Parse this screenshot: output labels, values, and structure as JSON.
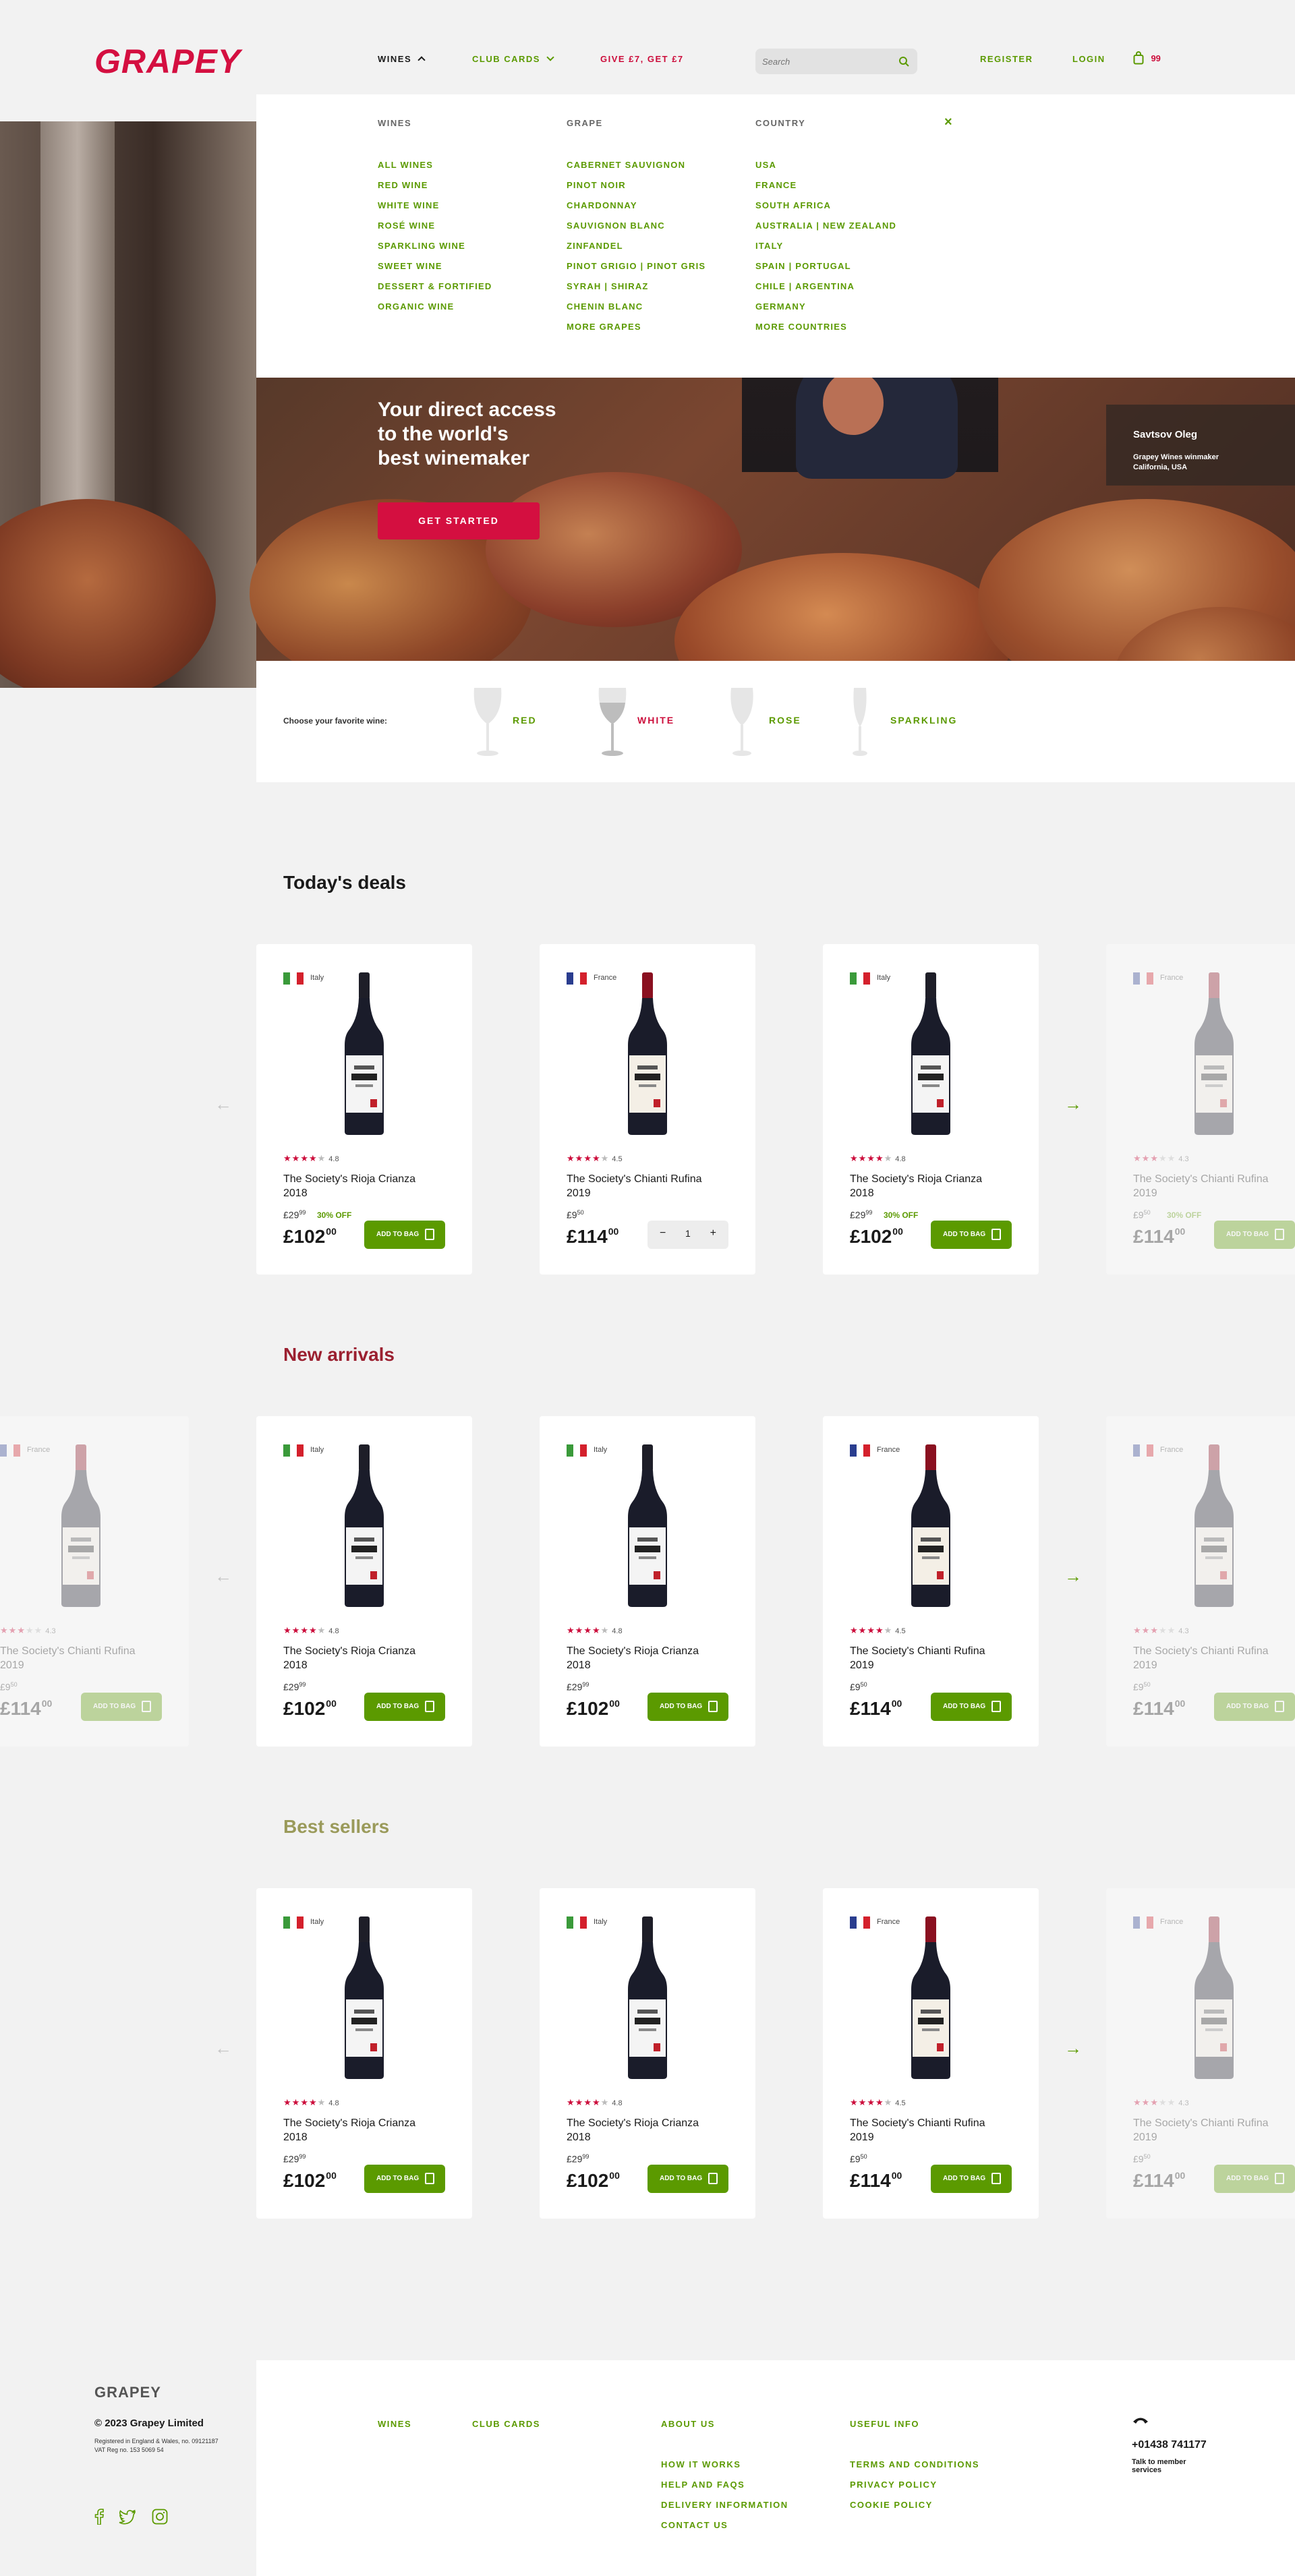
{
  "header": {
    "logo": "GRAPEY",
    "nav": {
      "wines": "WINES",
      "club_cards": "CLUB CARDS",
      "promo": "GIVE £7, GET £7"
    },
    "search_placeholder": "Search",
    "register": "REGISTER",
    "login": "LOGIN",
    "cart_count": "99"
  },
  "menu": {
    "columns": [
      {
        "title": "WINES",
        "items": [
          "ALL WINES",
          "RED WINE",
          "WHITE WINE",
          "ROSÉ WINE",
          "SPARKLING WINE",
          "SWEET WINE",
          "DESSERT & FORTIFIED",
          "ORGANIC WINE"
        ]
      },
      {
        "title": "GRAPE",
        "items": [
          "CABERNET SAUVIGNON",
          "PINOT NOIR",
          "CHARDONNAY",
          "SAUVIGNON BLANC",
          "ZINFANDEL",
          "PINOT GRIGIO | PINOT GRIS",
          "SYRAH | SHIRAZ",
          "CHENIN BLANC",
          "MORE GRAPES"
        ]
      },
      {
        "title": "COUNTRY",
        "items": [
          "USA",
          "FRANCE",
          "SOUTH AFRICA",
          "AUSTRALIA | NEW ZEALAND",
          "ITALY",
          "SPAIN | PORTUGAL",
          "CHILE | ARGENTINA",
          "GERMANY",
          "MORE COUNTRIES"
        ]
      }
    ],
    "close": "×"
  },
  "hero": {
    "headline_1": "Your direct access",
    "headline_2": "to the world's",
    "headline_3": "best winemaker",
    "cta": "GET STARTED",
    "person_name": "Savtsov Oleg",
    "person_role_1": "Grapey Wines winmaker",
    "person_role_2": "California, USA"
  },
  "chooser": {
    "label": "Choose your favorite wine:",
    "options": [
      "RED",
      "WHITE",
      "ROSE",
      "SPARKLING"
    ]
  },
  "sections": [
    {
      "title": "Today's deals",
      "products": [
        {
          "country": "Italy",
          "rating": "4.8",
          "name_1": "The Society's Rioja Crianza",
          "name_2": "2018",
          "old_price": "£29",
          "old_cents": "99",
          "discount": "30% OFF",
          "price": "£102",
          "cents": "00",
          "button": "ADD TO BAG"
        },
        {
          "country": "France",
          "rating": "4.5",
          "name_1": "The Society's Chianti Rufina",
          "name_2": "2019",
          "old_price": "£9",
          "old_cents": "50",
          "discount": "",
          "price": "£114",
          "cents": "00",
          "qty": "1"
        },
        {
          "country": "Italy",
          "rating": "4.8",
          "name_1": "The Society's Rioja Crianza",
          "name_2": "2018",
          "old_price": "£29",
          "old_cents": "99",
          "discount": "30% OFF",
          "price": "£102",
          "cents": "00",
          "button": "ADD TO BAG"
        },
        {
          "country": "France",
          "rating": "4.3",
          "name_1": "The Society's Chianti Rufina",
          "name_2": "2019",
          "old_price": "£9",
          "old_cents": "50",
          "discount": "30% OFF",
          "price": "£114",
          "cents": "00",
          "button": "ADD TO BAG"
        }
      ]
    },
    {
      "title": "New arrivals",
      "products": [
        {
          "country": "France",
          "rating": "4.3",
          "name_1": "The Society's Chianti Rufina",
          "name_2": "2019",
          "old_price": "£9",
          "old_cents": "50",
          "discount": "",
          "price": "£114",
          "cents": "00",
          "button": "ADD TO BAG"
        },
        {
          "country": "Italy",
          "rating": "4.8",
          "name_1": "The Society's Rioja Crianza",
          "name_2": "2018",
          "old_price": "£29",
          "old_cents": "99",
          "discount": "",
          "price": "£102",
          "cents": "00",
          "button": "ADD TO BAG"
        },
        {
          "country": "Italy",
          "rating": "4.8",
          "name_1": "The Society's Rioja Crianza",
          "name_2": "2018",
          "old_price": "£29",
          "old_cents": "99",
          "discount": "",
          "price": "£102",
          "cents": "00",
          "button": "ADD TO BAG"
        },
        {
          "country": "France",
          "rating": "4.5",
          "name_1": "The Society's Chianti Rufina",
          "name_2": "2019",
          "old_price": "£9",
          "old_cents": "50",
          "discount": "",
          "price": "£114",
          "cents": "00",
          "button": "ADD TO BAG"
        },
        {
          "country": "France",
          "rating": "4.3",
          "name_1": "The Society's Chianti Rufina",
          "name_2": "2019",
          "old_price": "£9",
          "old_cents": "50",
          "discount": "",
          "price": "£114",
          "cents": "00",
          "button": "ADD TO BAG"
        }
      ]
    },
    {
      "title": "Best sellers",
      "products": [
        {
          "country": "Italy",
          "rating": "4.8",
          "name_1": "The Society's Rioja Crianza",
          "name_2": "2018",
          "old_price": "£29",
          "old_cents": "99",
          "discount": "",
          "price": "£102",
          "cents": "00",
          "button": "ADD TO BAG"
        },
        {
          "country": "Italy",
          "rating": "4.8",
          "name_1": "The Society's Rioja Crianza",
          "name_2": "2018",
          "old_price": "£29",
          "old_cents": "99",
          "discount": "",
          "price": "£102",
          "cents": "00",
          "button": "ADD TO BAG"
        },
        {
          "country": "France",
          "rating": "4.5",
          "name_1": "The Society's Chianti Rufina",
          "name_2": "2019",
          "old_price": "£9",
          "old_cents": "50",
          "discount": "",
          "price": "£114",
          "cents": "00",
          "button": "ADD TO BAG"
        },
        {
          "country": "France",
          "rating": "4.3",
          "name_1": "The Society's Chianti Rufina",
          "name_2": "2019",
          "old_price": "£9",
          "old_cents": "50",
          "discount": "",
          "price": "£114",
          "cents": "00",
          "button": "ADD TO BAG"
        }
      ]
    }
  ],
  "footer": {
    "logo": "GRAPEY",
    "copyright": "© 2023 Grapey Limited",
    "legal_1": "Registered in England & Wales, no. 09121187",
    "legal_2": "VAT Reg no. 153 5069 54",
    "col_wines": "WINES",
    "col_club": "CLUB CARDS",
    "about": {
      "title": "ABOUT US",
      "links": [
        "HOW IT WORKS",
        "HELP AND FAQS",
        "DELIVERY INFORMATION",
        "CONTACT US"
      ]
    },
    "useful": {
      "title": "USEFUL INFO",
      "links": [
        "TERMS AND CONDITIONS",
        "PRIVACY POLICY",
        "COOKIE POLICY"
      ]
    },
    "phone": "+01438 741177",
    "phone_note_1": "Talk to member",
    "phone_note_2": "services"
  },
  "colors": {
    "brand": "#d40f40",
    "accent": "#5b9a00",
    "new_arrivals_title": "#9b2030",
    "best_sellers_title": "#9a9a5a"
  }
}
